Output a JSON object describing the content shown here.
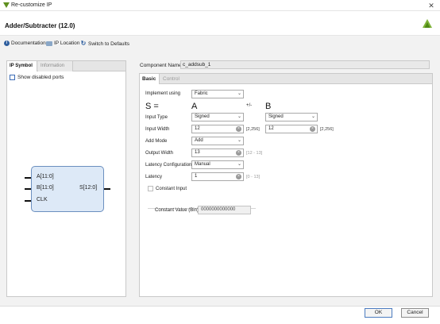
{
  "window": {
    "title": "Re-customize IP",
    "close_glyph": "✕",
    "app_icon": "vivado-icon"
  },
  "header": {
    "title": "Adder/Subtracter (12.0)",
    "logo": "xilinx-logo-icon"
  },
  "toolbar": {
    "documentation_label": "Documentation",
    "ip_location_label": "IP Location",
    "switch_defaults_label": "Switch to Defaults"
  },
  "left_panel": {
    "tabs": [
      {
        "label": "IP Symbol"
      },
      {
        "label": "Information"
      }
    ],
    "show_disabled_label": "Show disabled ports",
    "symbol": {
      "pin_a": "A[11:0]",
      "pin_b": "B[11:0]",
      "pin_clk": "CLK",
      "pin_s": "S[12:0]"
    }
  },
  "right_panel": {
    "component_name_label": "Component Name",
    "component_name_value": "c_addsub_1",
    "tabs": [
      {
        "label": "Basic"
      },
      {
        "label": "Control"
      }
    ],
    "implement_using": {
      "label": "Implement using",
      "value": "Fabric"
    },
    "s_label": "S =",
    "a_header": "A",
    "op_label": "+/-",
    "b_header": "B",
    "input_type": {
      "label": "Input Type",
      "a_value": "Signed",
      "b_value": "Signed"
    },
    "input_width": {
      "label": "Input Width",
      "a_value": "12",
      "a_range": "[2,256]",
      "b_value": "12",
      "b_range": "[2,256]"
    },
    "add_mode": {
      "label": "Add Mode",
      "value": "Add"
    },
    "output_width": {
      "label": "Output Width",
      "value": "13",
      "range": "[12 - 13]"
    },
    "latency_config": {
      "label": "Latency Configuration",
      "value": "Manual"
    },
    "latency": {
      "label": "Latency",
      "value": "1",
      "range": "[0 - 13]"
    },
    "constant_input_label": "Constant Input",
    "constant_value": {
      "label": "Constant Value (Bin)",
      "value": "0000000000000"
    }
  },
  "footer": {
    "ok_label": "OK",
    "cancel_label": "Cancel"
  }
}
